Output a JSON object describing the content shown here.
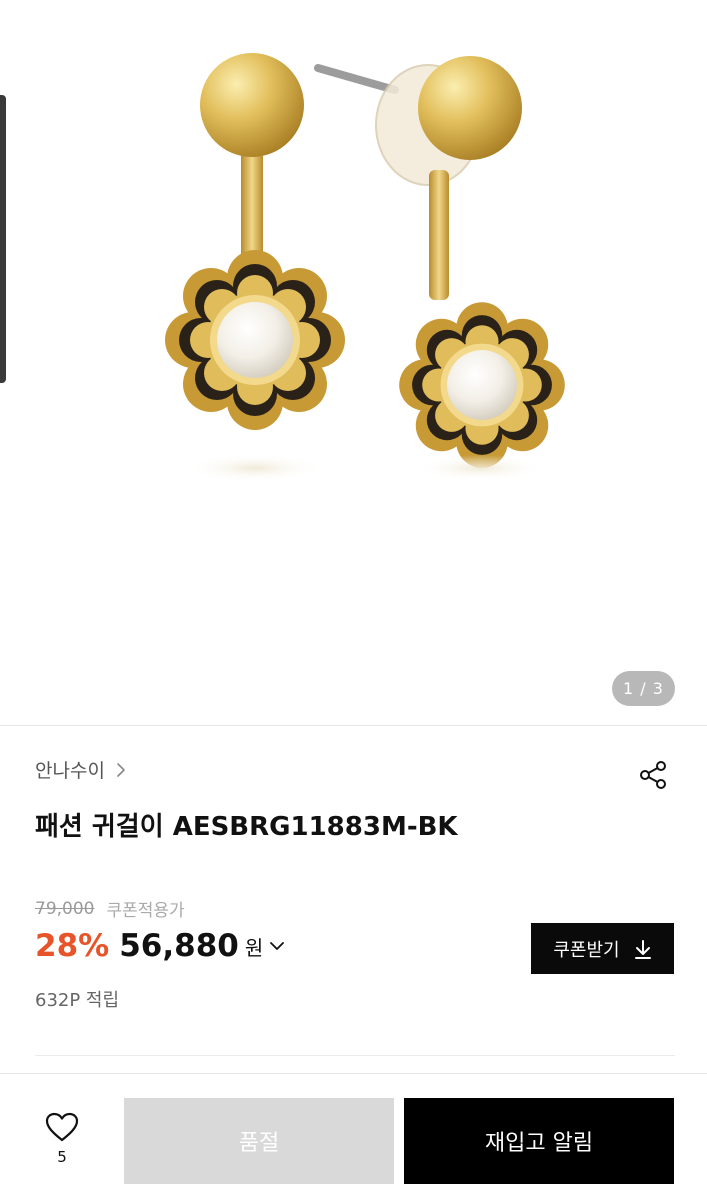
{
  "gallery": {
    "page_indicator": "1 / 3",
    "image_alt_icon": "earring-product-image"
  },
  "brand": {
    "name": "안나수이",
    "chevron_icon": "chevron-right-icon"
  },
  "share_icon": "share-icon",
  "product": {
    "title": "패션 귀걸이 AESBRG11883M-BK"
  },
  "price": {
    "original": "79,000",
    "coupon_note": "쿠폰적용가",
    "discount": "28%",
    "sale": "56,880",
    "currency": "원",
    "points": "632P 적립"
  },
  "coupon_button": {
    "label": "쿠폰받기",
    "icon": "download-icon"
  },
  "bottom_bar": {
    "like_count": "5",
    "soldout_label": "품절",
    "restock_label": "재입고 알림"
  },
  "colors": {
    "discount": "#e8542a",
    "primary_button": "#000000",
    "disabled_button": "#d9d9d9",
    "gold": "#d8b44a"
  }
}
